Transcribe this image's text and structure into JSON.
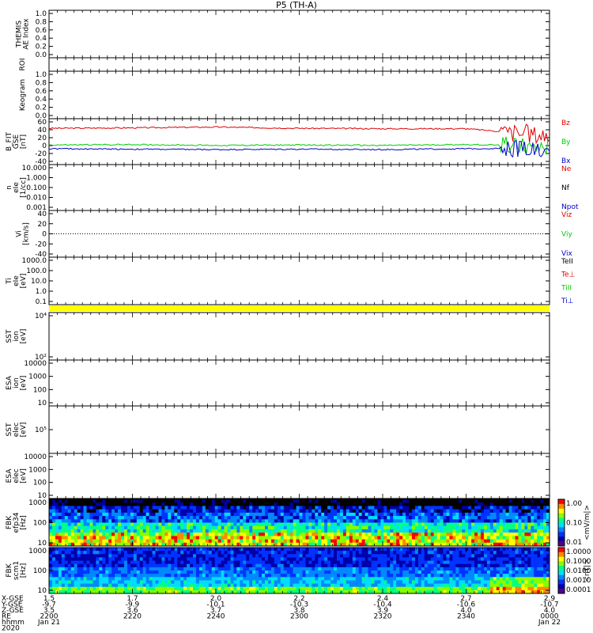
{
  "title": "P5 (TH-A)",
  "colors": {
    "red": "#dd0000",
    "green": "#00cc00",
    "blue": "#0000cc",
    "black": "#000000",
    "yellow": "#ffff00"
  },
  "panels": [
    {
      "id": "ae",
      "ylabel": [
        "THEMIS",
        "AE Index"
      ],
      "ticks": [
        "1.0",
        "0.8",
        "0.6",
        "0.4",
        "0.2",
        "0.0"
      ]
    },
    {
      "id": "roi",
      "ylabel": [
        "ROI"
      ],
      "ticks": []
    },
    {
      "id": "keogram",
      "ylabel": [
        "Keogram"
      ],
      "ticks": [
        "1.0",
        "0.8",
        "0.6",
        "0.4",
        "0.2",
        "0.0"
      ]
    },
    {
      "id": "bfit",
      "ylabel": [
        "B_FIT",
        "GSE",
        "[nT]"
      ],
      "ticks": [
        "60",
        "40",
        "20",
        "0",
        "-20",
        "-40"
      ],
      "legend": [
        "Bz",
        "By",
        "Bx"
      ]
    },
    {
      "id": "density",
      "ylabel": [
        "n",
        "eIe",
        "[1/cc]"
      ],
      "ticks": [
        "10.000",
        "1.000",
        "0.100",
        "0.010",
        "0.001"
      ],
      "legend": [
        "Ne",
        "Nf",
        "Npot"
      ]
    },
    {
      "id": "vi",
      "ylabel": [
        "Vi",
        "[km/s]"
      ],
      "ticks": [
        "40",
        "20",
        "0",
        "-20",
        "-40"
      ],
      "legend": [
        "Viz",
        "Viy",
        "Vix"
      ]
    },
    {
      "id": "ti",
      "ylabel": [
        "Ti",
        "eIe",
        "[eV]"
      ],
      "ticks": [
        "1000.0",
        "100.0",
        "10.0",
        "1.0",
        "0.1"
      ],
      "legend": [
        "TeII",
        "Te⊥",
        "TiII",
        "Ti⊥"
      ]
    },
    {
      "id": "sst_i",
      "ylabel": [
        "SST",
        "ion",
        "[eV]"
      ],
      "ticks": [
        "10⁴",
        "10²"
      ]
    },
    {
      "id": "esa_i",
      "ylabel": [
        "ESA",
        "ion",
        "[eV]"
      ],
      "ticks": [
        "10000",
        "1000",
        "100",
        "10"
      ]
    },
    {
      "id": "sst_e",
      "ylabel": [
        "SST",
        "elec",
        "[eV]"
      ],
      "ticks": [
        "10⁵"
      ]
    },
    {
      "id": "esa_e",
      "ylabel": [
        "ESA",
        "elec",
        "[eV]"
      ],
      "ticks": [
        "10000",
        "1000",
        "100",
        "10"
      ]
    },
    {
      "id": "fbk_e",
      "ylabel": [
        "FBK",
        "efp34",
        "[Hz]"
      ],
      "ticks": [
        "1000",
        "100",
        "10"
      ]
    },
    {
      "id": "fbk_b",
      "ylabel": [
        "FBK",
        "scm1",
        "[Hz]"
      ],
      "ticks": [
        "1000",
        "100",
        "10"
      ]
    }
  ],
  "colorbar_e": {
    "label": "<mV/m|>",
    "ticks": [
      "1.00",
      "0.10",
      "0.01"
    ]
  },
  "colorbar_b": {
    "label": "<nT|>",
    "ticks": [
      "1.0000",
      "0.1000",
      "0.0100",
      "0.0010",
      "0.0001"
    ]
  },
  "xaxis": {
    "row_labels": [
      "X-GSE",
      "Y-GSE",
      "Z-GSE",
      "RE",
      "hhmm",
      "2020"
    ],
    "columns": [
      [
        "1.5",
        "-9.7",
        "3.5",
        "2200",
        "Jan 21"
      ],
      [
        "1.7",
        "-9.9",
        "3.6",
        "2220",
        ""
      ],
      [
        "2.0",
        "-10.1",
        "3.7",
        "2240",
        ""
      ],
      [
        "2.2",
        "-10.3",
        "3.8",
        "2300",
        ""
      ],
      [
        "2.4",
        "-10.4",
        "3.9",
        "2320",
        ""
      ],
      [
        "2.7",
        "-10.6",
        "4.0",
        "2340",
        ""
      ],
      [
        "2.9",
        "-10.7",
        "4.0",
        "0000",
        "Jan 22"
      ]
    ]
  },
  "chart_data": {
    "type": "line",
    "title": "P5 (TH-A)",
    "x": [
      "2200",
      "2220",
      "2240",
      "2300",
      "2320",
      "2340",
      "0000"
    ],
    "series": [
      {
        "name": "Bz",
        "values": [
          37,
          38,
          40,
          37,
          36,
          36,
          20
        ]
      },
      {
        "name": "By",
        "values": [
          -3,
          -2,
          -4,
          -3,
          -4,
          -2,
          -5
        ]
      },
      {
        "name": "Bx",
        "values": [
          -12,
          -13,
          -14,
          -13,
          -14,
          -12,
          -10
        ]
      }
    ],
    "ylim": [
      -50,
      60
    ]
  }
}
